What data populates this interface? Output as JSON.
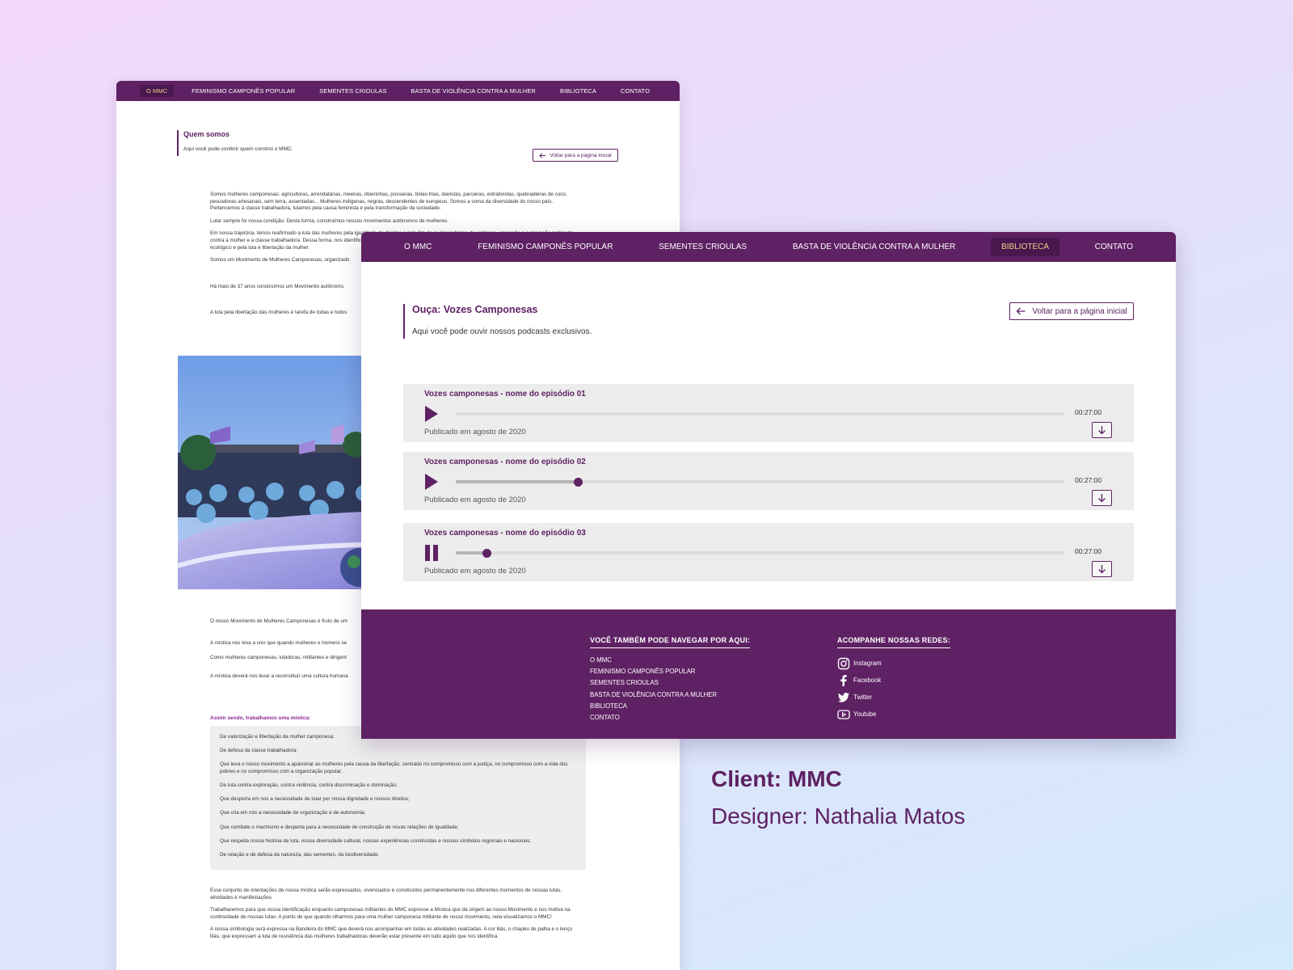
{
  "colors": {
    "brand_purple": "#5e2163",
    "nav_active_bg": "#4a174f",
    "nav_active_text": "#f2d28a",
    "episode_bg": "#ececec"
  },
  "back_window": {
    "nav": [
      "O MMC",
      "FEMINISMO CAMPONÊS POPULAR",
      "SEMENTES CRIOULAS",
      "BASTA DE VIOLÊNCIA CONTRA A MULHER",
      "BIBLIOTECA",
      "CONTATO"
    ],
    "active_nav": "O MMC",
    "title": "Quem somos",
    "subtitle": "Aqui você pode conferir quem constroi o MMC.",
    "back_button": "Voltar para a página inicial",
    "paragraphs_top": [
      "Somos mulheres camponesas: agricultoras, arrendatárias, meeiras, ribeirinhas, posseiras, bóias-frias, diaristas, parceiras, extrativistas, quebradeiras de coco, pescadoras artesanais, sem terra, assentadas... Mulheres indígenas, negras, descendentes de europeus. Somos a soma da diversidade do nosso país. Pertencemos à classe trabalhadora, lutamos pela causa feminista e pela transformação da sociedade.",
      "Lutar sempre foi nossa condição. Desta forma, construímos nossos movimentos autônomos de mulheres.",
      "Em nossa trajetória, temos reafirmado a luta das mulheres pela igualdade de direitos e pelo fim de qualquer forma de violência, opressão e exploração praticada contra a mulher e a classe trabalhadora. Dessa forma, nos identificamos pela produção de alimentos saudáveis, pela construção de um projeto de agricultura ecológico e pela luta e libertação da mulher.",
      "Somos um Movimento de Mulheres Camponesas, organizado",
      "Há mais de 37 anos construímos um Movimento autônomo,",
      "A luta pela libertação das mulheres é tarefa de todas e todos"
    ],
    "paragraphs_bottom": [
      "O nosso Movimento de Mulheres Camponesas é fruto de um",
      "A mística nos leva a crer que quando mulheres e homens se",
      "Como mulheres camponesas, lutadoras, militantes e dirigent",
      "A mística deverá nos levar a reconstituir uma cultura humana"
    ],
    "list_label": "Assim sendo, trabalhamos uma mística:",
    "list_items": [
      "De valorização e libertação da mulher camponesa;",
      "De defesa da classe trabalhadora;",
      "Que leva o nosso movimento a apaixonar as mulheres pela causa da libertação, centrado no compromisso com a justiça, no compromisso com a vida dos pobres e no compromisso com a organização popular;",
      "De luta contra exploração, contra violência, contra discriminação e dominação;",
      "Que desperta em nos a necessidade de lutar por nossa dignidade e nossos direitos;",
      "Que cria em nós a necessidade de organização e de autonomia;",
      "Que combate o machismo e desperta para a necessidade de construção de novas relações de igualdade;",
      "Que respeita nossa história de luta, nossa diversidade cultural, nossas experiências construídas e nossos símbolos regionais e nacionais;",
      "De relação e de defesa da natureza, das sementes, da biodiversidade."
    ],
    "paragraphs_end": [
      "Esse conjunto de orientações de nossa mística serão expressados, vivenciados e construídos permanentemente nos diferentes momentos de nossas lutas, atividades e manifestações.",
      "Trabalharemos para que nossa identificação enquanto camponesas militantes do MMC expresse a Mística que dá origem ao nosso Movimento e nos motiva na continuidade de nossas lutas. A ponto de que quando olharmos para uma mulher camponesa militante de nosso movimento, nela visualizamos o MMC!",
      "A nossa simbologia será expressa na Bandeira do MMC que deverá nos acompanhar em todas as atividades realizadas. A cor lilás, o chapéu de palha e o lenço lilás, que expressam a luta de resistência das mulheres trabalhadoras deverão estar presente em tudo aquilo que nos identifica."
    ]
  },
  "front_window": {
    "nav": [
      "O MMC",
      "FEMINISMO CAMPONÊS POPULAR",
      "SEMENTES CRIOULAS",
      "BASTA DE VIOLÊNCIA CONTRA A MULHER",
      "BIBLIOTECA",
      "CONTATO"
    ],
    "active_nav": "BIBLIOTECA",
    "title": "Ouça: Vozes Camponesas",
    "subtitle": "Aqui você pode ouvir nossos podcasts exclusivos.",
    "back_button": "Voltar para a página inicial",
    "episodes": [
      {
        "title": "Vozes camponesas - nome do episódio 01",
        "duration": "00:27:00",
        "published": "Publicado em agosto de 2020",
        "state": "paused",
        "progress": 0
      },
      {
        "title": "Vozes camponesas - nome do episódio 02",
        "duration": "00:27:00",
        "published": "Publicado em agosto de 2020",
        "state": "paused",
        "progress": 0.2
      },
      {
        "title": "Vozes camponesas - nome do episódio 03",
        "duration": "00:27:00",
        "published": "Publicado em agosto de 2020",
        "state": "playing",
        "progress": 0.05
      }
    ],
    "footer": {
      "nav_heading": "VOCÊ TAMBÉM PODE NAVEGAR POR AQUI:",
      "nav_links": [
        "O MMC",
        "FEMINISMO CAMPONÊS POPULAR",
        "SEMENTES CRIOULAS",
        "BASTA DE VIOLÊNCIA CONTRA A MULHER",
        "BIBLIOTECA",
        "CONTATO"
      ],
      "social_heading": "ACOMPANHE NOSSAS REDES:",
      "social": [
        {
          "label": "Instagram",
          "icon": "instagram-icon"
        },
        {
          "label": "Facebook",
          "icon": "facebook-icon"
        },
        {
          "label": "Twitter",
          "icon": "twitter-icon"
        },
        {
          "label": "Youtube",
          "icon": "youtube-icon"
        }
      ]
    }
  },
  "credits": {
    "client": "Client: MMC",
    "designer": "Designer: Nathalia Matos"
  }
}
